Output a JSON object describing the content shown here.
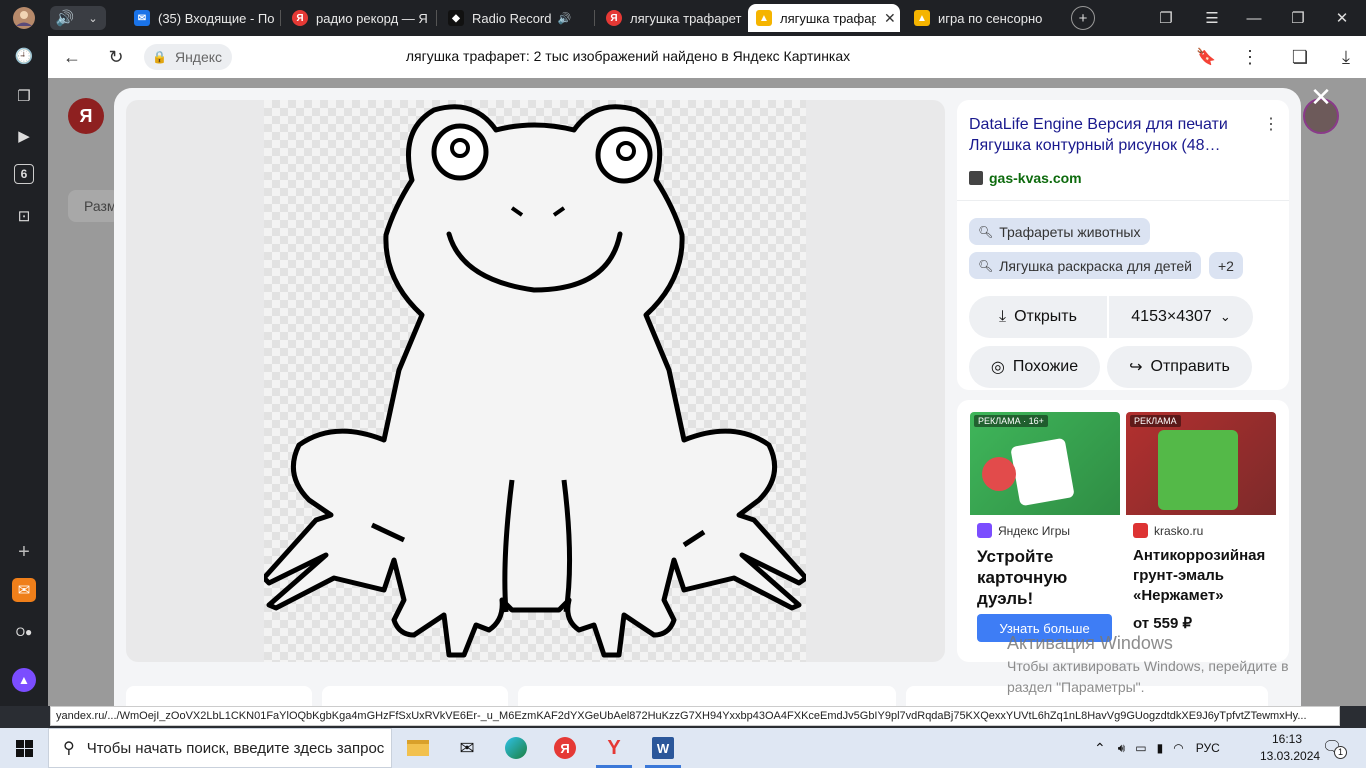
{
  "tabs": [
    {
      "label": "(35) Входящие - По",
      "icon": "mail-icon",
      "color": "#1a73e8"
    },
    {
      "label": "радио рекорд — Я",
      "icon": "yandex-icon",
      "color": "#e53935"
    },
    {
      "label": "Radio Record",
      "icon": "record-icon",
      "color": "#111111"
    },
    {
      "label": "лягушка трафарет",
      "icon": "yandex-icon",
      "color": "#e53935"
    },
    {
      "label": "лягушка трафар",
      "icon": "images-icon",
      "color": "#f5b400",
      "active": true
    },
    {
      "label": "игра по сенсорно",
      "icon": "images-icon",
      "color": "#f5b400"
    }
  ],
  "address": {
    "site": "Яндекс",
    "title": "лягушка трафарет: 2 тыс изображений найдено в Яндекс Картинках"
  },
  "info": {
    "title_line1": "DataLife Engine Версия для печати",
    "title_line2": "Лягушка контурный рисунок (48…",
    "domain": "gas-kvas.com",
    "chips": [
      "Трафареты животных",
      "Лягушка раскраска для детей",
      "+2"
    ],
    "open_label": "Открыть",
    "size_label": "4153×4307",
    "similar_label": "Похожие",
    "share_label": "Отправить"
  },
  "ads": [
    {
      "label": "РЕКЛАМА · 16+",
      "source": "Яндекс Игры",
      "title": "Устройте карточную дуэль!",
      "cta": "Узнать больше"
    },
    {
      "label": "РЕКЛАМА",
      "source": "krasko.ru",
      "title": "Антикоррозийная грунт-эмаль «Нержамет»",
      "price": "от 559 ₽"
    }
  ],
  "watermark": {
    "title": "Активация Windows",
    "text": "Чтобы активировать Windows, перейдите в раздел \"Параметры\"."
  },
  "status_url": "yandex.ru/.../WmOejI_zOoVX2LbL1CKN01FaYlOQbKgbKga4mGHzFfSxUxRVkVE6Er-_u_M6EzmKAF2dYXGeUbAel872HuKzzG7XH94Yxxbp43OA4FXKceEmdJv5GbIY9pl7vdRqdaBj75KXQexxYUVtL6hZq1nL8HavVg9GUogzdtdkXE9J6yTpfvtZTewmxHy...",
  "taskbar": {
    "search_placeholder": "Чтобы начать поиск, введите здесь запрос",
    "lang": "РУС",
    "time": "16:13",
    "date": "13.03.2024",
    "notif_count": "1"
  },
  "sidebar": {
    "badge": "6"
  },
  "bg": {
    "size_hint": "Разм"
  },
  "colors": {
    "accent": "#3e7df5",
    "link": "#1a1a8e",
    "domain": "#0e6b0e",
    "chip_bg": "#dbe3f2"
  }
}
